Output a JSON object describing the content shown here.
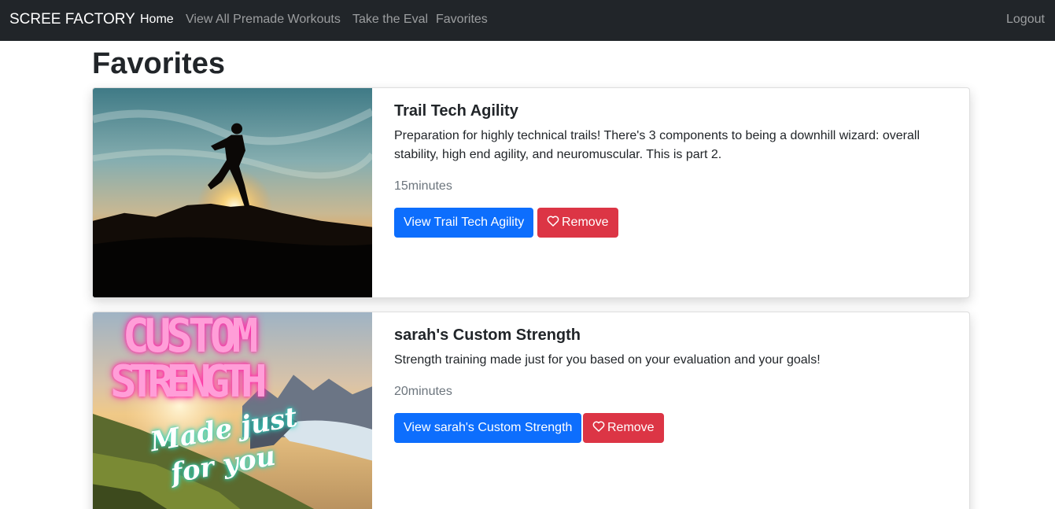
{
  "navbar": {
    "brand": "SCREE FACTORY",
    "links": [
      {
        "label": "Home"
      },
      {
        "label": "View All Premade Workouts"
      },
      {
        "label": "Take the Eval"
      },
      {
        "label": "Favorites"
      }
    ],
    "logout": "Logout"
  },
  "page": {
    "title": "Favorites"
  },
  "favorites": [
    {
      "title": "Trail Tech Agility",
      "description": "Preparation for highly technical trails! There's 3 components to being a downhill wizard: overall stability, high end agility, and neuromuscular. This is part 2.",
      "duration": "15minutes",
      "view_button": "View Trail Tech Agility",
      "remove_button": "Remove",
      "image": "runner-silhouette-sunset-photo"
    },
    {
      "title": "sarah's Custom Strength",
      "description": "Strength training made just for you based on your evaluation and your goals!",
      "duration": "20minutes",
      "view_button": "View sarah's Custom Strength",
      "remove_button": "Remove",
      "image": "custom-strength-mountain-fjord-graphic",
      "image_text": {
        "line1": "CUSTOM",
        "line2": "STRENGTH",
        "line3": "Made just",
        "line4": "for you"
      }
    }
  ],
  "colors": {
    "navbar_bg": "#212529",
    "primary": "#0d6efd",
    "danger": "#dc3545",
    "muted": "#6c757d",
    "neon_pink": "#ff6ec7",
    "neon_teal": "#7ff5e0"
  }
}
